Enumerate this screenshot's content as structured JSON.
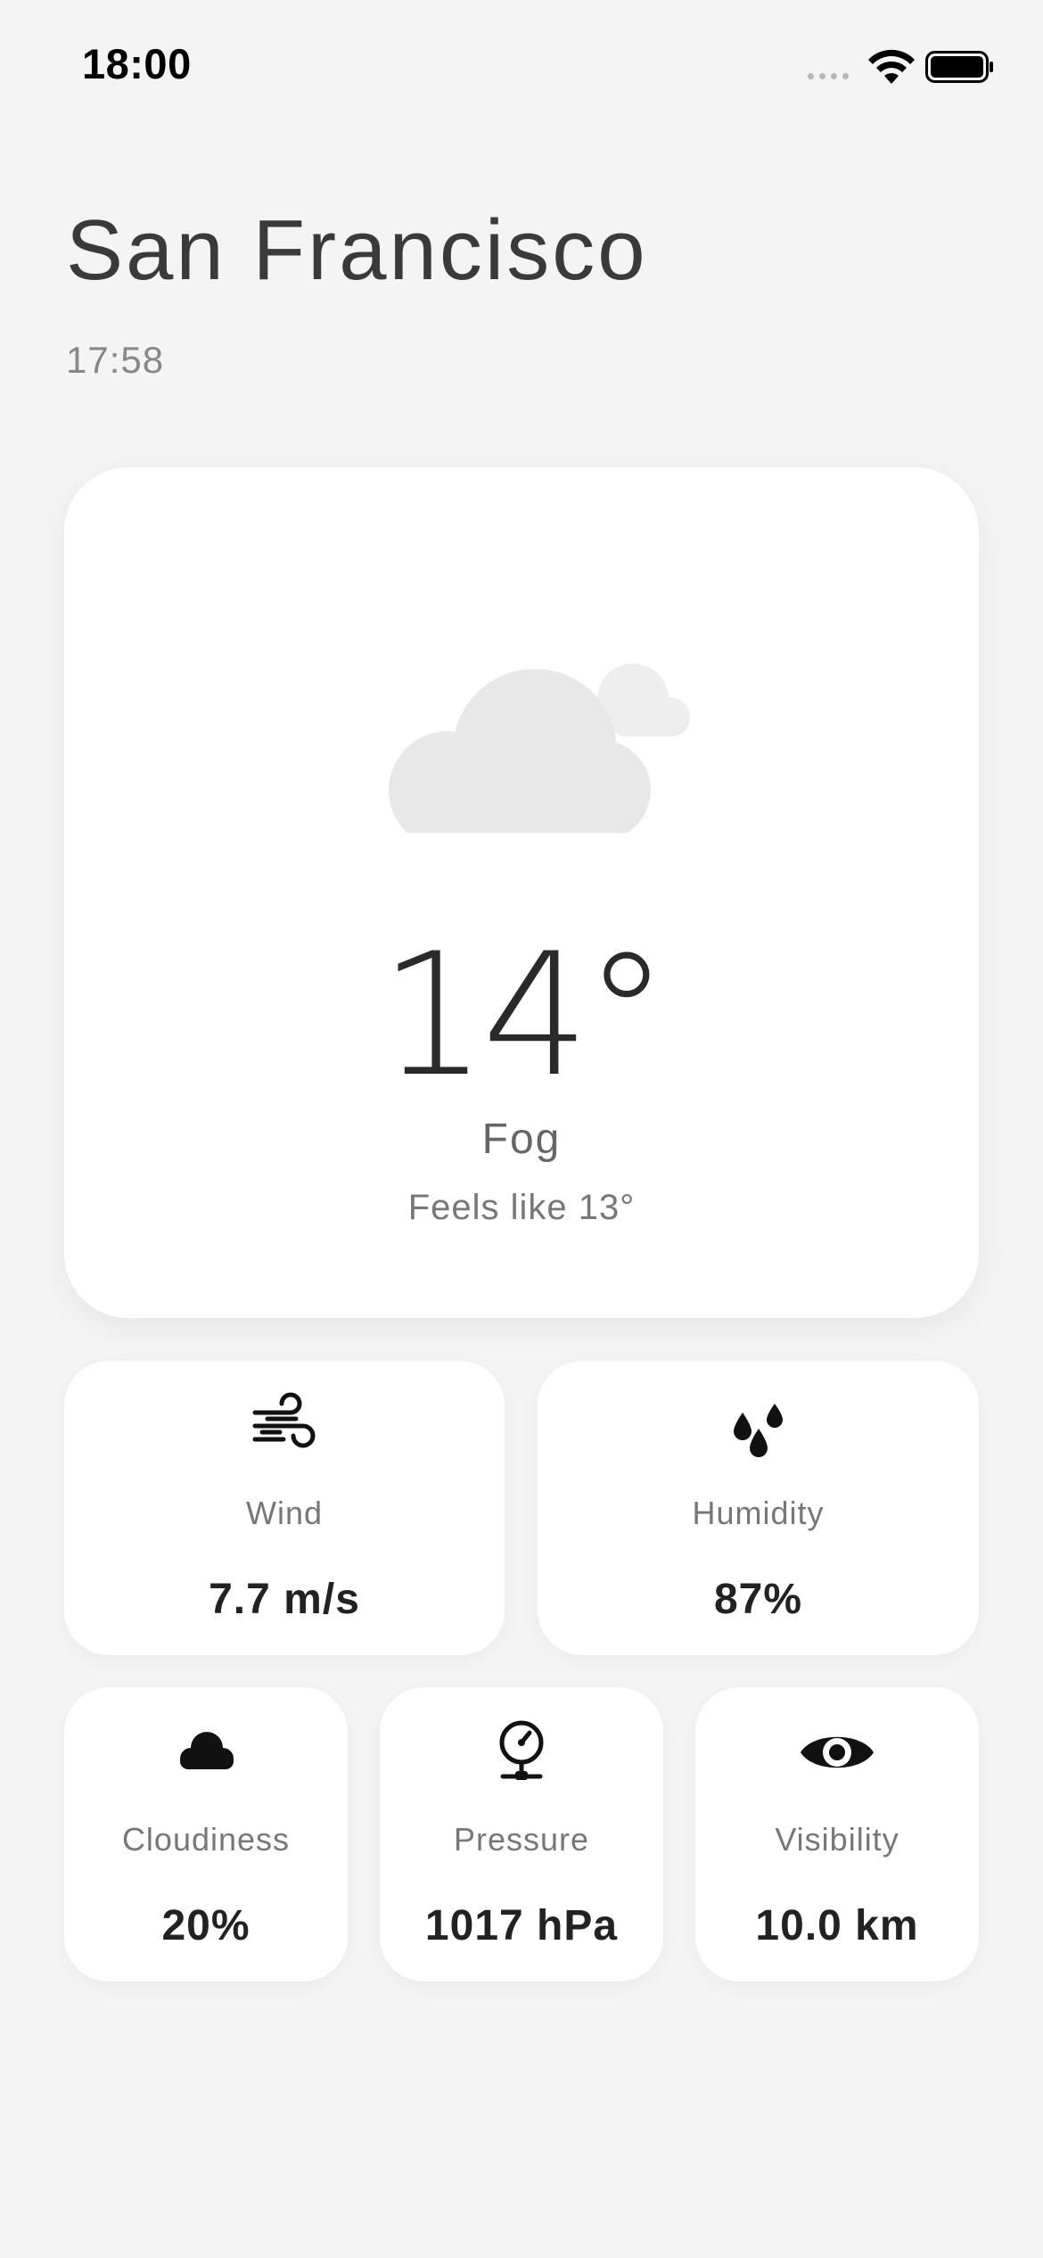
{
  "status_bar": {
    "time": "18:00"
  },
  "header": {
    "city": "San Francisco",
    "updated_time": "17:58"
  },
  "current": {
    "icon": "cloud-icon",
    "temperature": "14°",
    "condition": "Fog",
    "feels_like": "Feels like 13°"
  },
  "stats": {
    "wind": {
      "icon": "wind-icon",
      "label": "Wind",
      "value": "7.7 m/s"
    },
    "humidity": {
      "icon": "humidity-drops-icon",
      "label": "Humidity",
      "value": "87%"
    },
    "cloudiness": {
      "icon": "cloud-filled-icon",
      "label": "Cloudiness",
      "value": "20%"
    },
    "pressure": {
      "icon": "gauge-icon",
      "label": "Pressure",
      "value": "1017 hPa"
    },
    "visibility": {
      "icon": "eye-icon",
      "label": "Visibility",
      "value": "10.0 km"
    }
  },
  "colors": {
    "background": "#f4f4f4",
    "card": "#ffffff",
    "cloud": "#e8e8e8",
    "text_primary": "#222222",
    "text_secondary": "#777777"
  }
}
